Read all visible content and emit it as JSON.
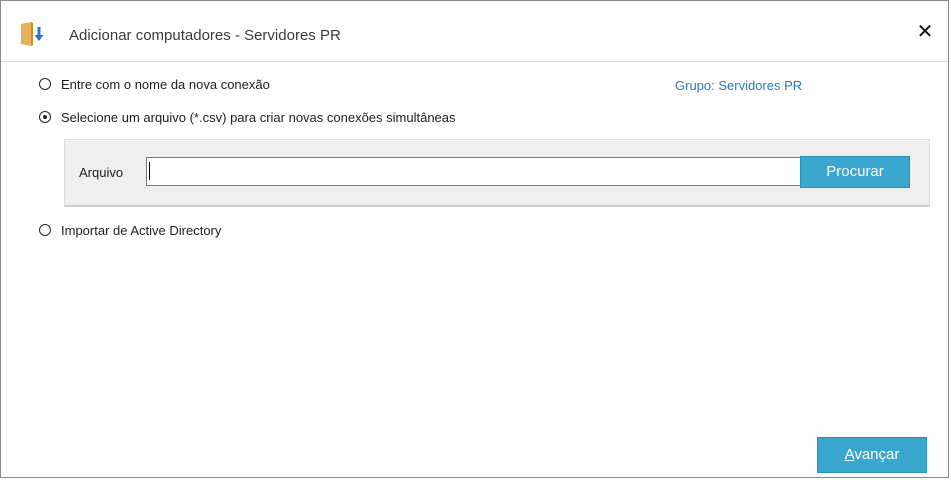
{
  "window": {
    "title": "Adicionar computadores - Servidores PR",
    "title_icon": "folder-import-icon",
    "close_icon": "close-icon",
    "close_glyph": "✕"
  },
  "options": [
    {
      "label": "Entre com o nome da nova conexão",
      "selected": false
    },
    {
      "label": "Selecione um arquivo (*.csv)  para criar novas conexões simultâneas",
      "selected": true
    },
    {
      "label": "Importar de Active Directory",
      "selected": false
    }
  ],
  "group_label": "Grupo: Servidores PR",
  "file_picker": {
    "label": "Arquivo",
    "value": "",
    "browse_label": "Procurar"
  },
  "footer": {
    "next_label_mnemonic": "A",
    "next_label_rest": "vançar"
  },
  "colors": {
    "accent": "#3aa7cf",
    "link": "#2a7ab8",
    "panel": "#efefef"
  }
}
